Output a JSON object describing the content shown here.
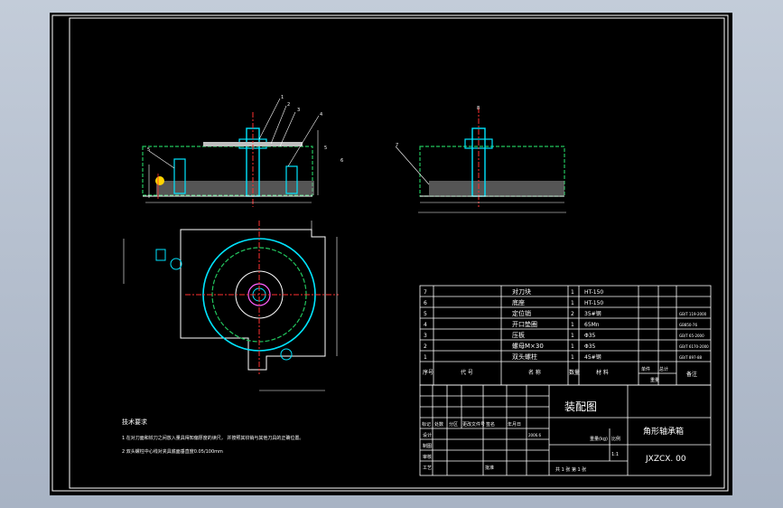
{
  "technical_requirements": {
    "heading": "技术要求",
    "items": [
      "1  在对刀面和铰刀之间放入量具得知偏厚度的读尺，  并按照其铰销与其他刀具的正确位置。",
      "2  双头螺柱中心线对夹具底面垂直度0.05/100mm"
    ]
  },
  "bom": {
    "rows": [
      {
        "no": "7",
        "name": "对刀块",
        "qty": "1",
        "material": "HT-150",
        "note": ""
      },
      {
        "no": "6",
        "name": "底座",
        "qty": "1",
        "material": "HT-150",
        "note": ""
      },
      {
        "no": "5",
        "name": "定位销",
        "qty": "2",
        "material": "35#钢",
        "note": "GB/T 119-2000"
      },
      {
        "no": "4",
        "name": "开口垫圈",
        "qty": "1",
        "material": "65Mn",
        "note": "GB850-76"
      },
      {
        "no": "3",
        "name": "压板",
        "qty": "1",
        "material": "Φ35",
        "note": "GB/T 65-2000"
      },
      {
        "no": "2",
        "name": "螺母M×30",
        "qty": "1",
        "material": "Φ35",
        "note": "GB/T 6170-2000"
      },
      {
        "no": "1",
        "name": "双头螺柱",
        "qty": "1",
        "material": "45#钢",
        "note": "GB/T 897-88"
      }
    ],
    "header": {
      "no": "序号",
      "code": "代 号",
      "name": "名 称",
      "qty": "数量",
      "material": "材 料",
      "unit_weight": "单件",
      "total_weight": "总计",
      "weight": "重量",
      "note": "备注"
    }
  },
  "title_block": {
    "drawing_type": "装配图",
    "part_name": "角形轴承箱",
    "drawing_no": "JXZCX. 00",
    "rows": [
      "标记",
      "处数",
      "分区",
      "更改文件号",
      "签名",
      "年月日"
    ],
    "left_labels": [
      "设计",
      "制图",
      "审核",
      "工艺"
    ],
    "date": "2006.6",
    "approve": "批准",
    "weight_label": "重量(kg)",
    "scale_label": "比例",
    "scale": "1:1",
    "sheet_info": "共 1 张  第 1 张"
  },
  "part_balloons": [
    "1",
    "2",
    "3",
    "4",
    "5",
    "6",
    "7",
    "8"
  ]
}
